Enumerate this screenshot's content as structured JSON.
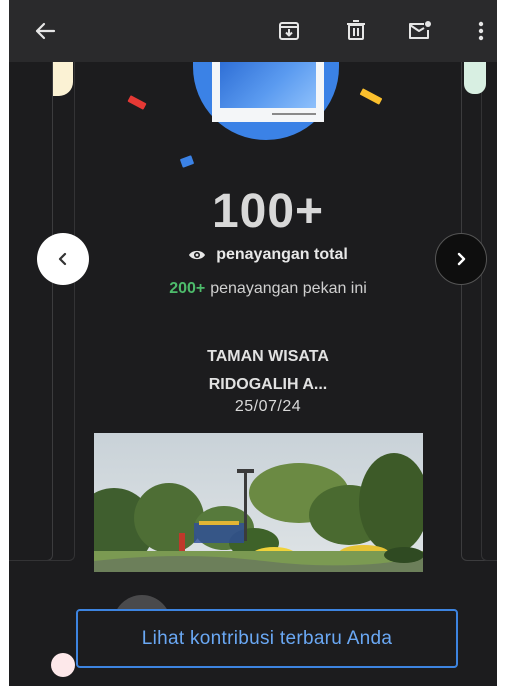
{
  "toolbar": {
    "back_icon": "arrow-left-icon",
    "archive_icon": "archive-download-icon",
    "delete_icon": "trash-icon",
    "mail_icon": "mail-unread-icon",
    "more_icon": "more-vert-icon"
  },
  "card": {
    "views_total": "100+",
    "views_total_label": "penayangan total",
    "views_week_count": "200+",
    "views_week_label": "penayangan pekan ini",
    "place_line1": "TAMAN WISATA",
    "place_line2": "RIDOGALIH A...",
    "date": "25/07/24"
  },
  "carousel": {
    "prev_icon": "chevron-left-icon",
    "next_icon": "chevron-right-icon"
  },
  "cta": {
    "label": "Lihat kontribusi terbaru Anda"
  },
  "colors": {
    "accent_blue": "#3d84e0",
    "positive_green": "#4dbb6b",
    "background": "#1c1c1e"
  }
}
